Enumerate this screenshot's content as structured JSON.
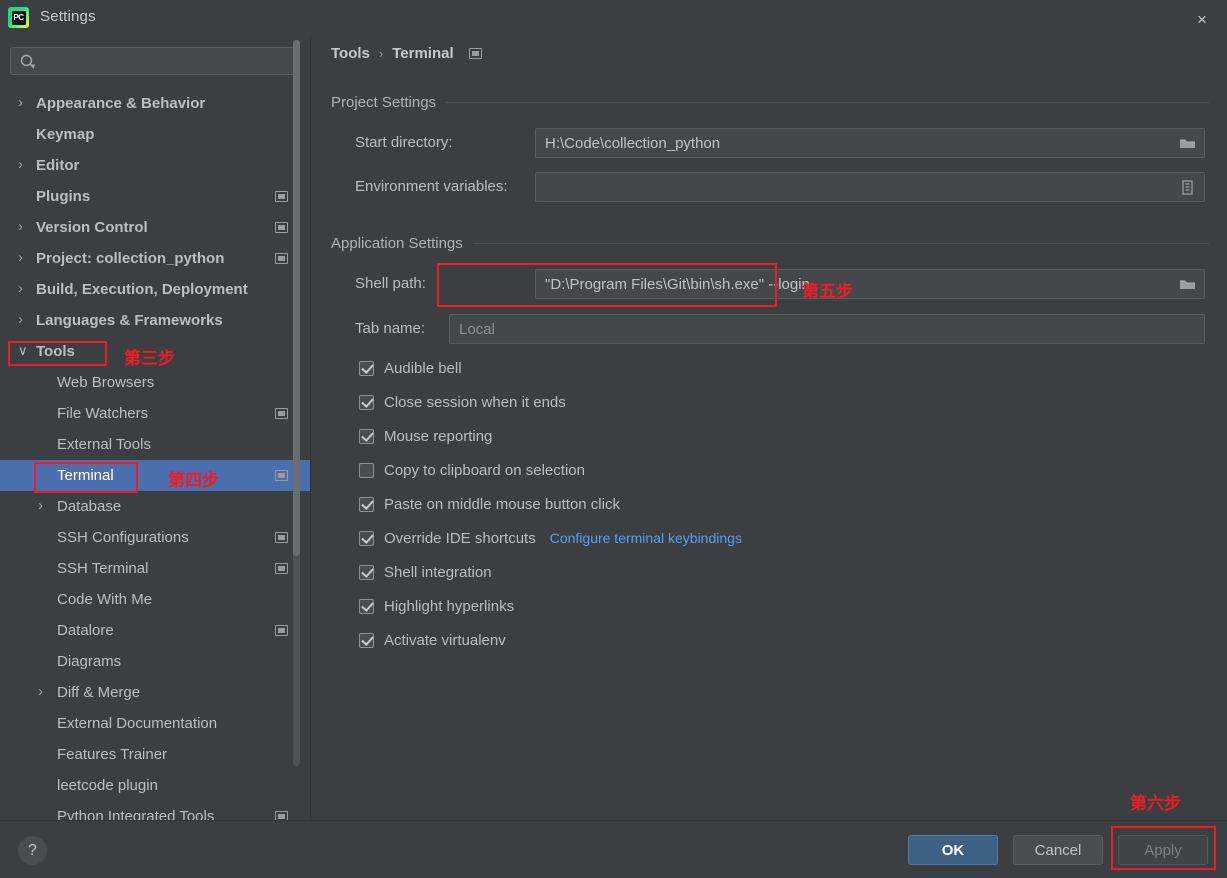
{
  "window": {
    "title": "Settings",
    "logo_text": "PC",
    "close_icon": "×"
  },
  "sidebar": {
    "search": {
      "placeholder": "",
      "value": "",
      "icon": "search-icon"
    },
    "items": [
      {
        "label": "Appearance & Behavior",
        "level": 1,
        "arrow": "right",
        "badge": false,
        "selected": false
      },
      {
        "label": "Keymap",
        "level": 1,
        "arrow": "none",
        "badge": false,
        "selected": false
      },
      {
        "label": "Editor",
        "level": 1,
        "arrow": "right",
        "badge": false,
        "selected": false
      },
      {
        "label": "Plugins",
        "level": 1,
        "arrow": "none",
        "badge": true,
        "selected": false
      },
      {
        "label": "Version Control",
        "level": 1,
        "arrow": "right",
        "badge": true,
        "selected": false
      },
      {
        "label": "Project: collection_python",
        "level": 1,
        "arrow": "right",
        "badge": true,
        "selected": false
      },
      {
        "label": "Build, Execution, Deployment",
        "level": 1,
        "arrow": "right",
        "badge": false,
        "selected": false
      },
      {
        "label": "Languages & Frameworks",
        "level": 1,
        "arrow": "right",
        "badge": false,
        "selected": false
      },
      {
        "label": "Tools",
        "level": 1,
        "arrow": "down",
        "badge": false,
        "selected": false
      },
      {
        "label": "Web Browsers",
        "level": 2,
        "arrow": "none",
        "badge": false,
        "selected": false
      },
      {
        "label": "File Watchers",
        "level": 2,
        "arrow": "none",
        "badge": true,
        "selected": false
      },
      {
        "label": "External Tools",
        "level": 2,
        "arrow": "none",
        "badge": false,
        "selected": false
      },
      {
        "label": "Terminal",
        "level": 2,
        "arrow": "none",
        "badge": true,
        "selected": true
      },
      {
        "label": "Database",
        "level": 2,
        "arrow": "right",
        "badge": false,
        "selected": false
      },
      {
        "label": "SSH Configurations",
        "level": 2,
        "arrow": "none",
        "badge": true,
        "selected": false
      },
      {
        "label": "SSH Terminal",
        "level": 2,
        "arrow": "none",
        "badge": true,
        "selected": false
      },
      {
        "label": "Code With Me",
        "level": 2,
        "arrow": "none",
        "badge": false,
        "selected": false
      },
      {
        "label": "Datalore",
        "level": 2,
        "arrow": "none",
        "badge": true,
        "selected": false
      },
      {
        "label": "Diagrams",
        "level": 2,
        "arrow": "none",
        "badge": false,
        "selected": false
      },
      {
        "label": "Diff & Merge",
        "level": 2,
        "arrow": "right",
        "badge": false,
        "selected": false
      },
      {
        "label": "External Documentation",
        "level": 2,
        "arrow": "none",
        "badge": false,
        "selected": false
      },
      {
        "label": "Features Trainer",
        "level": 2,
        "arrow": "none",
        "badge": false,
        "selected": false
      },
      {
        "label": "leetcode plugin",
        "level": 2,
        "arrow": "none",
        "badge": false,
        "selected": false
      },
      {
        "label": "Python Integrated Tools",
        "level": 2,
        "arrow": "none",
        "badge": true,
        "selected": false
      }
    ]
  },
  "breadcrumb": {
    "root": "Tools",
    "separator": "›",
    "leaf": "Terminal",
    "badge_icon": "module-badge-icon"
  },
  "project_settings": {
    "group_title": "Project Settings",
    "start_directory": {
      "label": "Start directory:",
      "value": "H:\\Code\\collection_python",
      "icon": "folder-icon"
    },
    "environment_variables": {
      "label": "Environment variables:",
      "value": "",
      "icon": "list-icon"
    }
  },
  "application_settings": {
    "group_title": "Application Settings",
    "shell_path": {
      "label": "Shell path:",
      "value": "\"D:\\Program Files\\Git\\bin\\sh.exe\"  --login",
      "icon": "folder-icon"
    },
    "tab_name": {
      "label": "Tab name:",
      "value": "Local"
    },
    "checkboxes": [
      {
        "label": "Audible bell",
        "checked": true
      },
      {
        "label": "Close session when it ends",
        "checked": true
      },
      {
        "label": "Mouse reporting",
        "checked": true
      },
      {
        "label": "Copy to clipboard on selection",
        "checked": false
      },
      {
        "label": "Paste on middle mouse button click",
        "checked": true
      },
      {
        "label": "Override IDE shortcuts",
        "checked": true,
        "link": "Configure terminal keybindings"
      },
      {
        "label": "Shell integration",
        "checked": true
      },
      {
        "label": "Highlight hyperlinks",
        "checked": true
      },
      {
        "label": "Activate virtualenv",
        "checked": true
      }
    ]
  },
  "footer": {
    "help_label": "?",
    "ok_label": "OK",
    "cancel_label": "Cancel",
    "apply_label": "Apply"
  },
  "annotations": {
    "color": "#ee1d23",
    "step3": "第三步",
    "step4": "第四步",
    "step5": "第五步",
    "step6": "第六步"
  }
}
